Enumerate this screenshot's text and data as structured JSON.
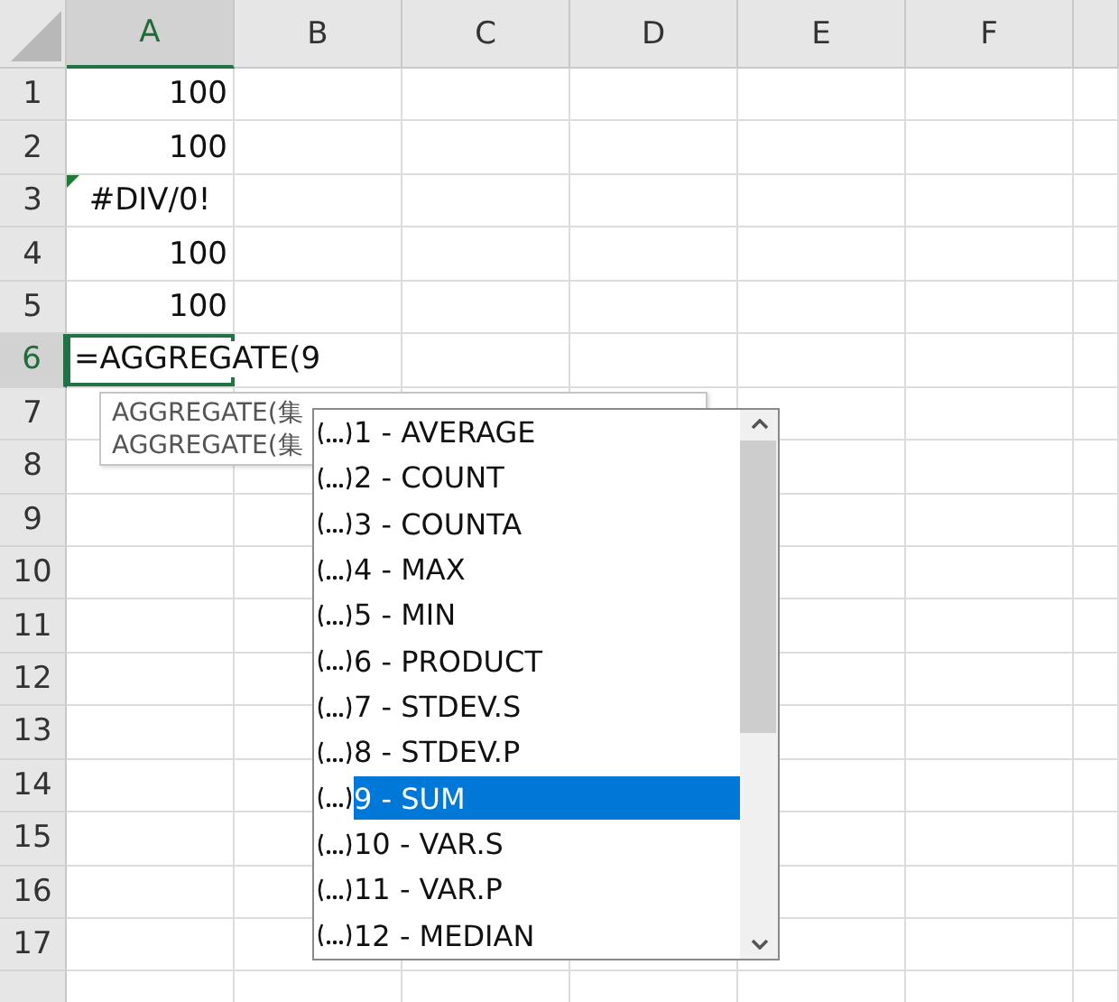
{
  "columns": [
    {
      "label": "A",
      "selected": true
    },
    {
      "label": "B",
      "selected": false
    },
    {
      "label": "C",
      "selected": false
    },
    {
      "label": "D",
      "selected": false
    },
    {
      "label": "E",
      "selected": false
    },
    {
      "label": "F",
      "selected": false
    }
  ],
  "rows": [
    {
      "label": "1",
      "selected": false,
      "cell": {
        "kind": "number",
        "text": "100"
      }
    },
    {
      "label": "2",
      "selected": false,
      "cell": {
        "kind": "number",
        "text": "100"
      }
    },
    {
      "label": "3",
      "selected": false,
      "cell": {
        "kind": "error",
        "text": "#DIV/0!"
      }
    },
    {
      "label": "4",
      "selected": false,
      "cell": {
        "kind": "number",
        "text": "100"
      }
    },
    {
      "label": "5",
      "selected": false,
      "cell": {
        "kind": "number",
        "text": "100"
      }
    },
    {
      "label": "6",
      "selected": true,
      "cell": {
        "kind": "editing",
        "text": "=AGGREGATE(9"
      }
    },
    {
      "label": "7",
      "selected": false
    },
    {
      "label": "8",
      "selected": false
    },
    {
      "label": "9",
      "selected": false
    },
    {
      "label": "10",
      "selected": false
    },
    {
      "label": "11",
      "selected": false
    },
    {
      "label": "12",
      "selected": false
    },
    {
      "label": "13",
      "selected": false
    },
    {
      "label": "14",
      "selected": false
    },
    {
      "label": "15",
      "selected": false
    },
    {
      "label": "16",
      "selected": false
    },
    {
      "label": "17",
      "selected": false
    }
  ],
  "tooltip": {
    "lines": [
      "AGGREGATE(集",
      "AGGREGATE(集"
    ]
  },
  "autocomplete": {
    "items": [
      {
        "label": "1 - AVERAGE",
        "selected": false
      },
      {
        "label": "2 - COUNT",
        "selected": false
      },
      {
        "label": "3 - COUNTA",
        "selected": false
      },
      {
        "label": "4 - MAX",
        "selected": false
      },
      {
        "label": "5 - MIN",
        "selected": false
      },
      {
        "label": "6 - PRODUCT",
        "selected": false
      },
      {
        "label": "7 - STDEV.S",
        "selected": false
      },
      {
        "label": "8 - STDEV.P",
        "selected": false
      },
      {
        "label": "9 - SUM",
        "selected": true
      },
      {
        "label": "10 - VAR.S",
        "selected": false
      },
      {
        "label": "11 - VAR.P",
        "selected": false
      },
      {
        "label": "12 - MEDIAN",
        "selected": false
      }
    ]
  }
}
